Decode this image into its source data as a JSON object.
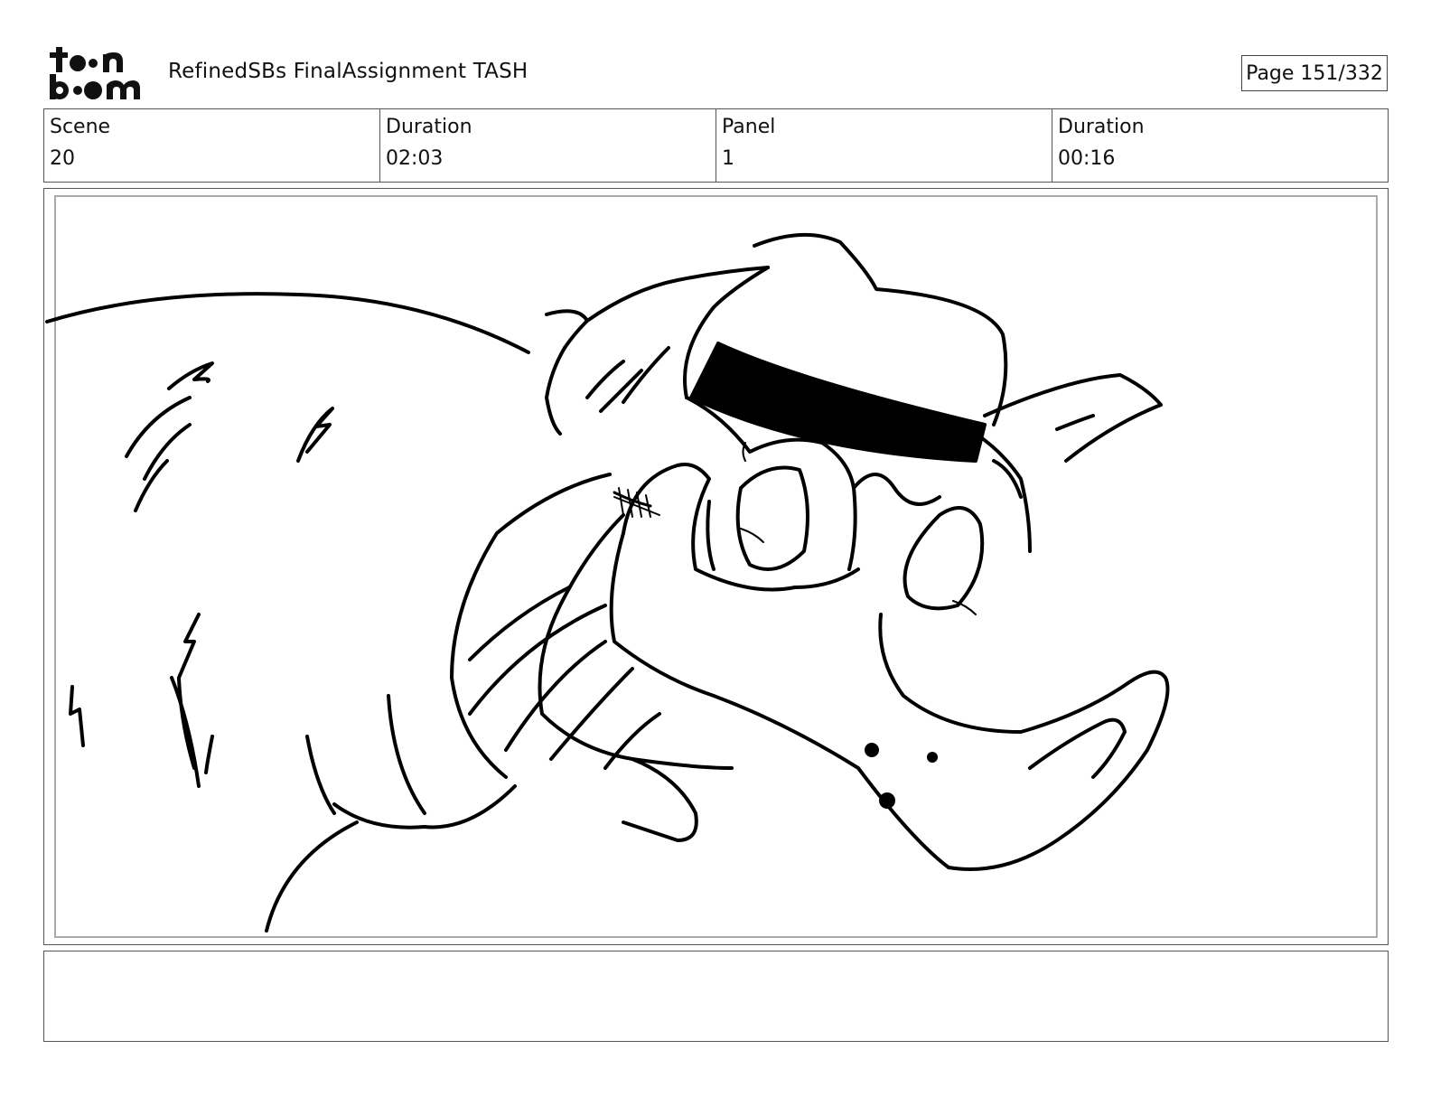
{
  "header": {
    "logo_text": "toonboom",
    "document_title": "RefinedSBs FinalAssignment TASH",
    "page_label": "Page 151/332"
  },
  "info": [
    {
      "label": "Scene",
      "value": "20"
    },
    {
      "label": "Duration",
      "value": "02:03"
    },
    {
      "label": "Panel",
      "value": "1"
    },
    {
      "label": "Duration",
      "value": "00:16"
    }
  ],
  "panel": {
    "image": "storyboard-sketch-creature-with-hat-and-tongue"
  },
  "notes": {
    "text": ""
  }
}
